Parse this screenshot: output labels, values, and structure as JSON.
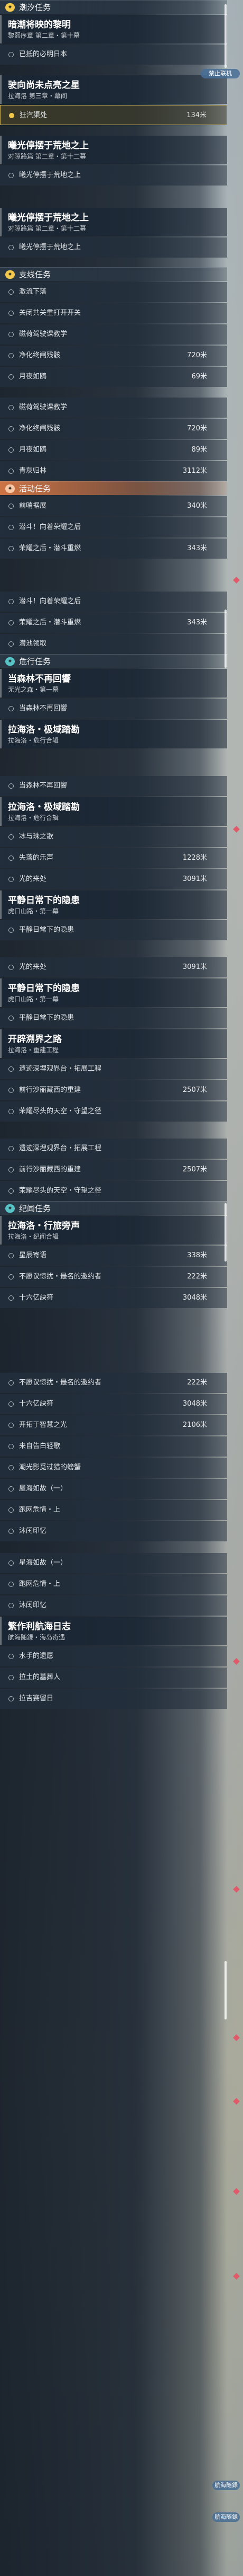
{
  "sections": {
    "s1": "潮汐任务",
    "s2": "支线任务",
    "s3": "活动任务",
    "s4": "危行任务",
    "s5": "纪闻任务"
  },
  "cards": {
    "c1": {
      "title": "暗潮将映的黎明",
      "sub": "黎熙序章 第二章・第十幕"
    },
    "c2": {
      "title": "驶向尚未点亮之星",
      "sub": "拉海洛 第三章・幕间"
    },
    "c3": {
      "title": "曦光停摆于荒地之上",
      "sub": "对隙路篇 第二章・第十二幕"
    },
    "c4": {
      "title": "曦光停摆于荒地之上",
      "sub": "对隙路篇 第二章・第十二幕"
    },
    "c5": {
      "title": "当森林不再回響",
      "sub": "无光之森・第一幕"
    },
    "c6": {
      "title": "拉海洛・极域踏勘",
      "sub": "拉海洛・危行合辑"
    },
    "c7": {
      "title": "拉海洛・极域踏勘",
      "sub": "拉海洛・危行合辑"
    },
    "c8": {
      "title": "平静日常下的隐患",
      "sub": "虎口山路・第一幕"
    },
    "c9": {
      "title": "平静日常下的隐患",
      "sub": "虎口山路・第一幕"
    },
    "c10": {
      "title": "开辟溯界之路",
      "sub": "拉海洛・重建工程"
    },
    "c11": {
      "title": "拉海洛・行旅旁声",
      "sub": "拉海洛・纪闻合辑"
    },
    "c12": {
      "title": "繁作利航海日志",
      "sub": "航海随録・海岛奇遇"
    }
  },
  "items": {
    "i1": "已抵的必明日本",
    "i2": "狂汽渠处",
    "v2": "134米",
    "i3": "曦光停摆于荒地之上",
    "i4": "曦光停摆于荒地之上",
    "i5": "激流下落",
    "i6": "关闭共关重打开开关",
    "i7": "磁荷驾驶课教学",
    "i8": "净化终闸残骸",
    "v8": "720米",
    "i9": "月夜如鸥",
    "v9": "69米",
    "i10": "磁荷驾驶课教学",
    "i11": "净化终闸残骸",
    "v11": "720米",
    "i12": "月夜如鸥",
    "v12": "89米",
    "i13": "青灰归林",
    "v13": "3112米",
    "i14": "前哨据展",
    "v14": "340米",
    "i15": "潜斗！向着荣耀之后",
    "i16": "荣耀之后・潜斗重燃",
    "v16": "343米",
    "i17": "潜斗！向着荣耀之后",
    "i18": "荣耀之后・潜斗重燃",
    "v18": "343米",
    "i19": "潜池领取",
    "i20": "当森林不再回響",
    "i21": "当森林不再回響",
    "i22": "冰与珠之歌",
    "i23": "失落的乐声",
    "v23": "1228米",
    "i24": "光的来处",
    "v24": "3091米",
    "i25": "平静日常下的隐患",
    "i26": "光的来处",
    "v26": "3091米",
    "i27": "平静日常下的隐患",
    "i28": "遗迹深埋观界台・拓展工程",
    "i29": "前行沙丽藏西的重建",
    "v29": "2507米",
    "i30": "荣耀尽头的天空・守望之径",
    "i31": "遗迹深埋观界台・拓展工程",
    "i32": "前行沙丽藏西的重建",
    "v32": "2507米",
    "i33": "荣耀尽头的天空・守望之径",
    "i34": "星辰寄语",
    "v34": "338米",
    "i35": "不愿议惊扰・最名的邀约者",
    "v35": "222米",
    "i36": "十六亿訣符",
    "v36": "3048米",
    "i37": "",
    "i38": "不愿议惊扰・最名的邀约者",
    "v38": "222米",
    "i39": "十六亿訣符",
    "v39": "3048米",
    "i40": "开拓于智慧之光",
    "v40": "2106米",
    "i41": "来自告白轻歌",
    "i42": "潮光影觅过猎的螃蟹",
    "i43": "屋海如故（一）",
    "i44": "跑网危情・上",
    "i45": "沐闰印忆",
    "i46": "星海如故（一）",
    "i47": "跑网危情・上",
    "i48": "沐闰印忆",
    "i49": "水手的遗愿",
    "i50": "拉土的墓葬人",
    "i51": "拉吉赛留日"
  },
  "badges": {
    "b1": "禁止联机",
    "b2": "航海随録",
    "b3": "航海随録"
  }
}
